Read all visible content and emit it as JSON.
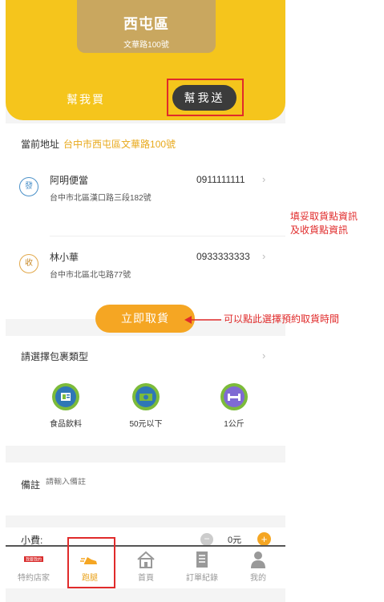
{
  "header": {
    "district_name": "西屯區",
    "district_address": "文華路100號",
    "tab_buy": "幫我買",
    "tab_send": "幫我送"
  },
  "address_section": {
    "current_label": "當前地址",
    "current_value": "台中市西屯區文華路100號",
    "sender": {
      "badge": "發",
      "name": "阿明便當",
      "phone": "0911111111",
      "address": "台中市北區漢口路三段182號"
    },
    "receiver": {
      "badge": "收",
      "name": "林小華",
      "phone": "0933333333",
      "address": "台中市北區北屯路77號"
    }
  },
  "pickup_button": "立即取貨",
  "package": {
    "title": "請選擇包裹類型",
    "options": [
      {
        "label": "食品飲料",
        "icon": "food-menu-icon"
      },
      {
        "label": "50元以下",
        "icon": "cash-icon"
      },
      {
        "label": "1公斤",
        "icon": "dumbbell-icon"
      }
    ]
  },
  "note": {
    "label": "備註",
    "placeholder": "請輸入備註"
  },
  "tip": {
    "label": "小費:",
    "value": "0元"
  },
  "tabbar": {
    "items": [
      {
        "label": "特約店家",
        "icon": "store-icon",
        "badge": "我要我的"
      },
      {
        "label": "跑腿",
        "icon": "running-shoe-icon"
      },
      {
        "label": "首頁",
        "icon": "home-icon"
      },
      {
        "label": "訂單紀錄",
        "icon": "document-icon"
      },
      {
        "label": "我的",
        "icon": "person-icon"
      }
    ]
  },
  "annotations": {
    "fill_info_line1": "填妥取貨點資訊",
    "fill_info_line2": "及收貨點資訊",
    "schedule_hint": "可以點此選擇預約取貨時間"
  },
  "colors": {
    "header_yellow": "#f5c51c",
    "accent_orange": "#f5a623",
    "annotation_red": "#e02b2b",
    "send_pill": "#3b3b3b"
  }
}
